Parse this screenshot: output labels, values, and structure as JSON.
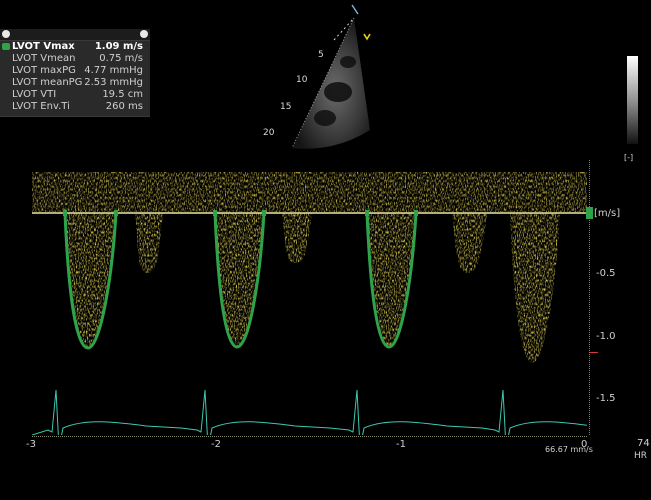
{
  "measurements": {
    "rows": [
      {
        "label": "LVOT Vmax",
        "value": "1.09 m/s",
        "active": true
      },
      {
        "label": "LVOT Vmean",
        "value": "0.75 m/s"
      },
      {
        "label": "LVOT maxPG",
        "value": "4.77 mmHg"
      },
      {
        "label": "LVOT meanPG",
        "value": "2.53 mmHg"
      },
      {
        "label": "LVOT VTI",
        "value": "19.5 cm"
      },
      {
        "label": "LVOT Env.Ti",
        "value": "260 ms"
      }
    ]
  },
  "sector": {
    "depth_ticks": [
      "5",
      "10",
      "15",
      "20"
    ]
  },
  "velocity_scale": {
    "unit": "[m/s]",
    "ticks": [
      "-0.5",
      "-1.0",
      "-1.5"
    ]
  },
  "time_axis": {
    "ticks": [
      "-3",
      "-2",
      "-1",
      "0"
    ],
    "sweep": "66.67 mm/s"
  },
  "heart_rate": {
    "value": "74",
    "unit": "HR"
  },
  "gray_bar_mark": "[-]",
  "colors": {
    "doppler": "#e8c21a",
    "trace": "#2ea34a",
    "ecg": "#3fc8b0",
    "baseline": "#f2e8a0"
  }
}
